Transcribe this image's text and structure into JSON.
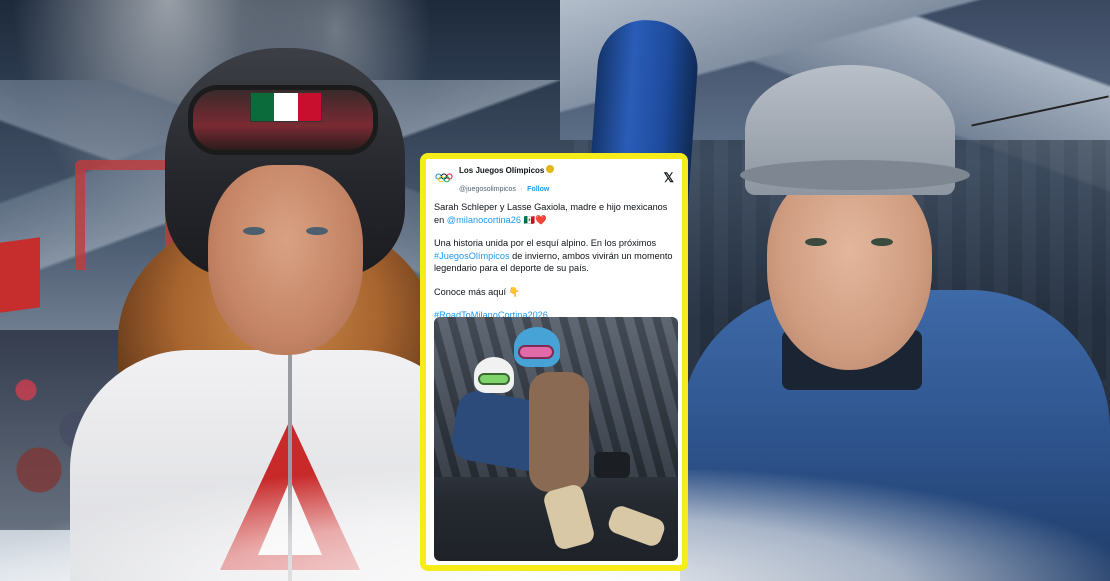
{
  "tweet": {
    "author_name": "Los Juegos Olímpicos",
    "handle": "@juegosolimpicos",
    "follow_label": "Follow",
    "separator": "·",
    "close_glyph": "𝕏",
    "paragraph1_text": "Sarah Schleper y Lasse Gaxiola, madre e hijo mexicanos en",
    "paragraph1_link": "@milanocortina26",
    "paragraph1_emoji": " 🇲🇽❤️",
    "paragraph2_text": "Una historia unida por el esquí alpino. En los próximos",
    "paragraph2_link": "#JuegosOlímpicos",
    "paragraph2_rest": " de invierno, ambos vivirán un momento legendario para el deporte de su país.",
    "paragraph3_text": "Conoce más aquí 👇",
    "hashtag": "#RoadToMilanoCortina2026"
  },
  "colors": {
    "highlight_border": "#f5ec1a",
    "link_blue": "#1d9bf0",
    "mexico_green": "#0b6b3a",
    "mexico_white": "#ffffff",
    "mexico_red": "#c8102e"
  }
}
